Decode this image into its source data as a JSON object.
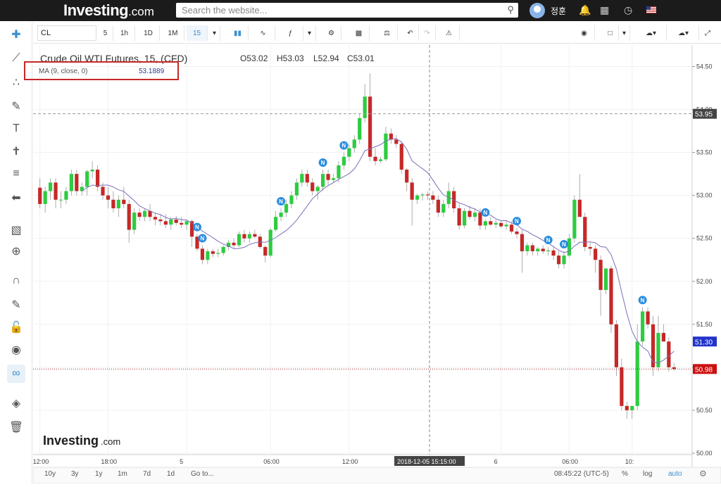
{
  "header": {
    "logo_main": "Investing",
    "logo_suffix": ".com",
    "search_placeholder": "Search the website...",
    "username": "정훈"
  },
  "toolbar": {
    "symbol": "CL",
    "intervals": [
      "5",
      "1h",
      "1D",
      "1M",
      "15"
    ],
    "active_interval": "15"
  },
  "legend": {
    "title": "Crude Oil WTI Futures, 15, (CFD)",
    "open": "O53.02",
    "high": "H53.03",
    "low": "L52.94",
    "close": "C53.01",
    "indicator": "MA (9, close, 0)",
    "indicator_value": "53.1889"
  },
  "bottom_bar": {
    "ranges": [
      "10y",
      "3y",
      "1y",
      "1m",
      "7d",
      "1d",
      "Go to..."
    ],
    "clock": "08:45:22 (UTC-5)",
    "options": [
      "%",
      "log",
      "auto"
    ]
  },
  "watermark": {
    "main": "Investing",
    "suffix": ".com"
  },
  "colors": {
    "up": "#2ecc40",
    "down": "#c62828",
    "ma": "#7a6fb8",
    "accent": "#3a8fd0"
  },
  "chart_data": {
    "type": "candlestick",
    "title": "Crude Oil WTI Futures, 15, (CFD)",
    "ylim": [
      50.0,
      54.75
    ],
    "y_ticks": [
      50.0,
      50.5,
      51.0,
      51.5,
      52.0,
      52.5,
      53.0,
      53.5,
      54.0,
      54.5
    ],
    "x_tick_labels": [
      "12:00",
      "18:00",
      "5",
      "06:00",
      "12:00",
      "6",
      "06:00",
      "10:"
    ],
    "price_labels": [
      {
        "value": 53.95,
        "label": "53.95",
        "style": "horizontal-dash"
      },
      {
        "value": 51.3,
        "label": "51.30",
        "style": "ma"
      },
      {
        "value": 50.98,
        "label": "50.98",
        "style": "last-price"
      }
    ],
    "crosshair_time_label": "2018-12-05 15:15:00",
    "news_markers": [
      {
        "index": 30,
        "label": "N"
      },
      {
        "index": 31,
        "label": "N"
      },
      {
        "index": 46,
        "label": "N"
      },
      {
        "index": 54,
        "label": "N"
      },
      {
        "index": 58,
        "label": "N"
      },
      {
        "index": 85,
        "label": "N"
      },
      {
        "index": 91,
        "label": "N"
      },
      {
        "index": 97,
        "label": "N"
      },
      {
        "index": 100,
        "label": "N"
      },
      {
        "index": 115,
        "label": "N"
      }
    ],
    "candles": [
      [
        53.09,
        53.2,
        52.85,
        52.9
      ],
      [
        52.9,
        53.1,
        52.8,
        53.05
      ],
      [
        53.05,
        53.2,
        52.95,
        53.15
      ],
      [
        53.15,
        53.2,
        52.85,
        52.95
      ],
      [
        52.95,
        53.05,
        52.85,
        52.95
      ],
      [
        52.95,
        53.1,
        52.9,
        53.05
      ],
      [
        53.05,
        53.3,
        53.0,
        53.25
      ],
      [
        53.25,
        53.3,
        53.0,
        53.05
      ],
      [
        53.05,
        53.15,
        53.0,
        53.1
      ],
      [
        53.1,
        53.3,
        53.0,
        53.28
      ],
      [
        53.28,
        53.4,
        53.2,
        53.3
      ],
      [
        53.3,
        53.35,
        53.05,
        53.1
      ],
      [
        53.1,
        53.15,
        52.95,
        53.0
      ],
      [
        53.0,
        53.1,
        52.85,
        52.95
      ],
      [
        52.95,
        53.05,
        52.8,
        52.85
      ],
      [
        52.85,
        53.0,
        52.75,
        52.95
      ],
      [
        52.95,
        53.1,
        52.85,
        52.9
      ],
      [
        52.9,
        52.95,
        52.45,
        52.6
      ],
      [
        52.6,
        52.85,
        52.55,
        52.8
      ],
      [
        52.8,
        52.85,
        52.7,
        52.75
      ],
      [
        52.75,
        52.85,
        52.7,
        52.82
      ],
      [
        52.82,
        52.9,
        52.7,
        52.75
      ],
      [
        52.75,
        52.8,
        52.65,
        52.72
      ],
      [
        52.72,
        52.78,
        52.65,
        52.7
      ],
      [
        52.7,
        52.78,
        52.62,
        52.66
      ],
      [
        52.66,
        52.75,
        52.6,
        52.72
      ],
      [
        52.72,
        52.76,
        52.65,
        52.68
      ],
      [
        52.68,
        52.75,
        52.62,
        52.66
      ],
      [
        52.66,
        52.72,
        52.6,
        52.7
      ],
      [
        52.7,
        52.72,
        52.4,
        52.52
      ],
      [
        52.52,
        52.55,
        52.35,
        52.38
      ],
      [
        52.38,
        52.42,
        52.2,
        52.25
      ],
      [
        52.25,
        52.38,
        52.2,
        52.35
      ],
      [
        52.35,
        52.38,
        52.28,
        52.32
      ],
      [
        52.32,
        52.38,
        52.28,
        52.33
      ],
      [
        52.33,
        52.42,
        52.3,
        52.4
      ],
      [
        52.4,
        52.48,
        52.36,
        52.45
      ],
      [
        52.45,
        52.5,
        52.38,
        52.42
      ],
      [
        52.42,
        52.58,
        52.4,
        52.55
      ],
      [
        52.55,
        52.6,
        52.45,
        52.5
      ],
      [
        52.5,
        52.58,
        52.45,
        52.55
      ],
      [
        52.55,
        52.6,
        52.5,
        52.52
      ],
      [
        52.52,
        52.55,
        52.38,
        52.4
      ],
      [
        52.4,
        52.42,
        52.22,
        52.3
      ],
      [
        52.3,
        52.62,
        52.28,
        52.6
      ],
      [
        52.6,
        52.82,
        52.58,
        52.75
      ],
      [
        52.75,
        52.85,
        52.7,
        52.8
      ],
      [
        52.8,
        52.95,
        52.75,
        52.9
      ],
      [
        52.9,
        53.05,
        52.85,
        53.0
      ],
      [
        53.0,
        53.2,
        52.95,
        53.15
      ],
      [
        53.15,
        53.3,
        53.1,
        53.25
      ],
      [
        53.25,
        53.3,
        53.1,
        53.15
      ],
      [
        53.15,
        53.2,
        53.0,
        53.05
      ],
      [
        53.05,
        53.12,
        52.95,
        53.1
      ],
      [
        53.1,
        53.3,
        53.05,
        53.25
      ],
      [
        53.25,
        53.3,
        53.12,
        53.18
      ],
      [
        53.18,
        53.25,
        53.15,
        53.2
      ],
      [
        53.2,
        53.4,
        53.15,
        53.35
      ],
      [
        53.35,
        53.5,
        53.3,
        53.45
      ],
      [
        53.45,
        53.6,
        53.4,
        53.55
      ],
      [
        53.55,
        53.7,
        53.5,
        53.65
      ],
      [
        53.65,
        53.95,
        53.6,
        53.9
      ],
      [
        53.9,
        54.3,
        53.85,
        54.15
      ],
      [
        54.15,
        54.42,
        53.4,
        53.45
      ],
      [
        53.45,
        53.55,
        53.35,
        53.4
      ],
      [
        53.4,
        53.45,
        53.38,
        53.42
      ],
      [
        53.42,
        53.8,
        53.4,
        53.72
      ],
      [
        53.72,
        53.78,
        53.6,
        53.65
      ],
      [
        53.65,
        53.7,
        53.55,
        53.6
      ],
      [
        53.6,
        53.62,
        53.25,
        53.3
      ],
      [
        53.3,
        53.32,
        53.05,
        53.15
      ],
      [
        53.15,
        53.2,
        52.65,
        52.95
      ],
      [
        52.95,
        53.02,
        52.9,
        53.0
      ],
      [
        53.0,
        53.03,
        52.94,
        53.01
      ],
      [
        53.01,
        53.05,
        52.95,
        53.0
      ],
      [
        53.0,
        53.05,
        52.9,
        52.95
      ],
      [
        52.95,
        53.0,
        52.75,
        52.8
      ],
      [
        52.8,
        52.95,
        52.75,
        52.9
      ],
      [
        52.9,
        53.15,
        52.85,
        53.05
      ],
      [
        53.05,
        53.1,
        52.8,
        52.85
      ],
      [
        52.85,
        52.9,
        52.6,
        52.65
      ],
      [
        52.65,
        52.85,
        52.62,
        52.82
      ],
      [
        52.82,
        52.88,
        52.72,
        52.75
      ],
      [
        52.75,
        52.85,
        52.7,
        52.8
      ],
      [
        52.8,
        52.85,
        52.6,
        52.65
      ],
      [
        52.65,
        52.72,
        52.6,
        52.7
      ],
      [
        52.7,
        52.75,
        52.64,
        52.66
      ],
      [
        52.66,
        52.72,
        52.62,
        52.68
      ],
      [
        52.68,
        52.7,
        52.62,
        52.64
      ],
      [
        52.64,
        52.7,
        52.6,
        52.66
      ],
      [
        52.66,
        52.7,
        52.55,
        52.58
      ],
      [
        52.58,
        52.62,
        52.5,
        52.55
      ],
      [
        52.55,
        52.6,
        52.1,
        52.35
      ],
      [
        52.35,
        52.45,
        52.3,
        52.42
      ],
      [
        52.42,
        52.45,
        52.3,
        52.35
      ],
      [
        52.35,
        52.4,
        52.3,
        52.38
      ],
      [
        52.38,
        52.42,
        52.32,
        52.35
      ],
      [
        52.35,
        52.4,
        52.3,
        52.36
      ],
      [
        52.36,
        52.4,
        52.25,
        52.3
      ],
      [
        52.3,
        52.35,
        52.15,
        52.2
      ],
      [
        52.2,
        52.35,
        52.15,
        52.3
      ],
      [
        52.3,
        52.55,
        52.28,
        52.5
      ],
      [
        52.5,
        53.0,
        52.45,
        52.95
      ],
      [
        52.95,
        53.25,
        52.9,
        52.75
      ],
      [
        52.75,
        52.8,
        52.35,
        52.4
      ],
      [
        52.4,
        52.45,
        52.3,
        52.38
      ],
      [
        52.38,
        52.42,
        52.1,
        52.25
      ],
      [
        52.25,
        52.3,
        51.6,
        51.9
      ],
      [
        51.9,
        52.15,
        51.85,
        52.15
      ],
      [
        52.15,
        52.18,
        51.4,
        51.5
      ],
      [
        51.5,
        51.55,
        50.9,
        51.0
      ],
      [
        51.0,
        51.1,
        50.5,
        50.55
      ],
      [
        50.55,
        50.6,
        50.4,
        50.5
      ],
      [
        50.5,
        50.55,
        50.4,
        50.55
      ],
      [
        50.55,
        51.5,
        50.5,
        51.3
      ],
      [
        51.3,
        51.7,
        51.25,
        51.65
      ],
      [
        51.65,
        51.7,
        51.45,
        51.5
      ],
      [
        51.5,
        51.6,
        50.9,
        51.0
      ],
      [
        51.0,
        51.6,
        50.95,
        51.4
      ],
      [
        51.4,
        51.5,
        51.3,
        51.3
      ],
      [
        51.3,
        51.35,
        50.95,
        51.0
      ],
      [
        51.0,
        51.05,
        50.96,
        50.98
      ]
    ],
    "ma_period": 9
  }
}
